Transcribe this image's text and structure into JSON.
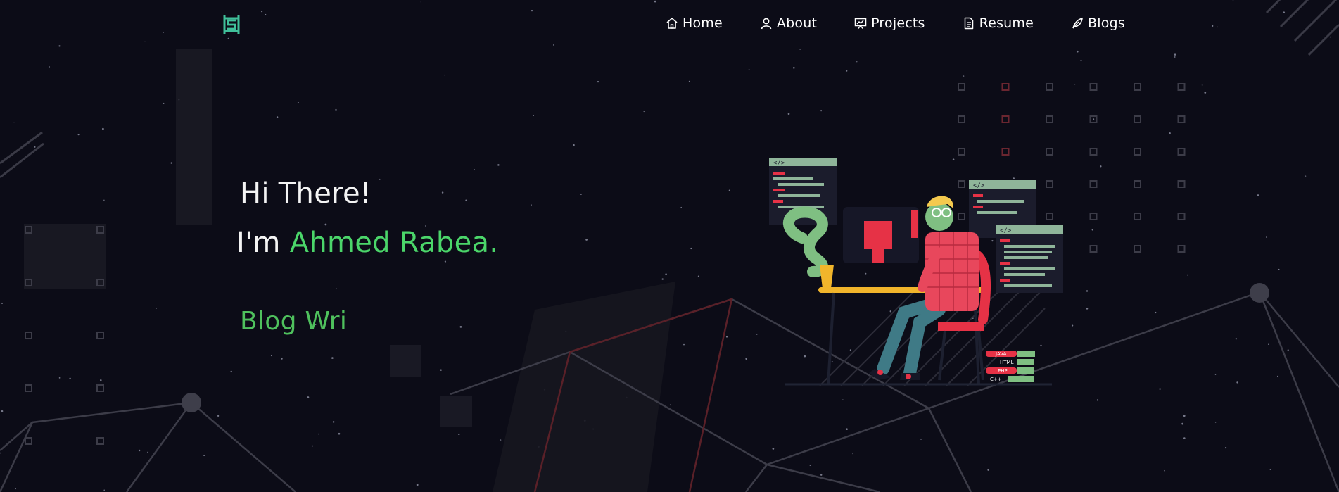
{
  "brand": {
    "logo_icon": "hexagon-s-logo-icon",
    "accent": "#4bd66a",
    "background": "#0c0c17"
  },
  "nav": {
    "items": [
      {
        "label": "Home",
        "icon": "home-icon"
      },
      {
        "label": "About",
        "icon": "user-icon"
      },
      {
        "label": "Projects",
        "icon": "presentation-icon"
      },
      {
        "label": "Resume",
        "icon": "document-icon"
      },
      {
        "label": "Blogs",
        "icon": "feather-icon"
      }
    ]
  },
  "hero": {
    "greeting": "Hi There!",
    "name_prefix": "I'm ",
    "name": "Ahmed Rabea.",
    "typed_text": "Blog Wri"
  },
  "illustration": {
    "tags": [
      "JAVA",
      "HTML",
      "PHP",
      "C++"
    ],
    "code_badge": "</>"
  }
}
